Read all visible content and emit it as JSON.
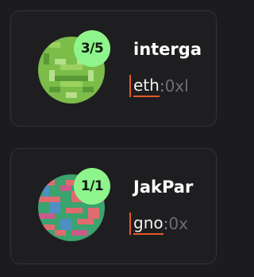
{
  "accounts": [
    {
      "count_badge": "3/5",
      "name": "interga",
      "chain": "eth",
      "separator": ":",
      "address_prefix": "0xl",
      "avatar_colors": [
        "#7cbd4a",
        "#9bd15e",
        "#5a9a36",
        "#b6e08a"
      ]
    },
    {
      "count_badge": "1/1",
      "name": "JakPar",
      "chain": "gno",
      "separator": ":",
      "address_prefix": "0x",
      "avatar_colors": [
        "#e06b6e",
        "#3aa36e",
        "#4e8fc4",
        "#c95a8a"
      ]
    }
  ],
  "colors": {
    "background": "#1c1c1e",
    "badge": "#8ef58d",
    "accent_underline": "#e25a2a"
  }
}
